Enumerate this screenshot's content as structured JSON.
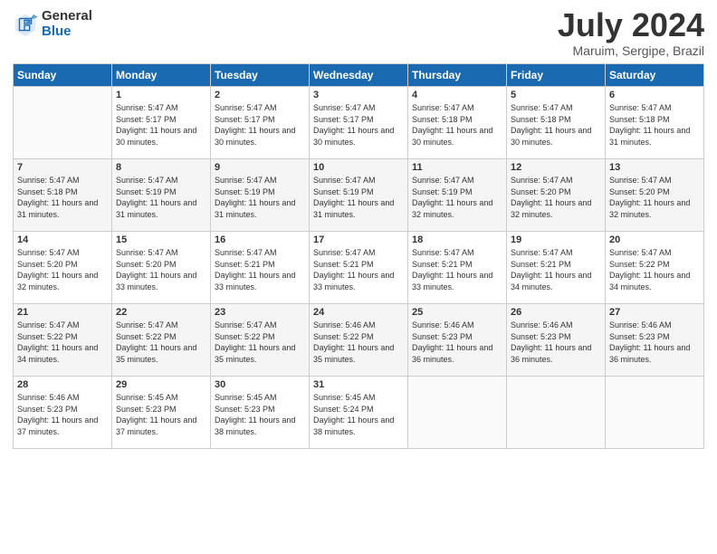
{
  "header": {
    "logo_general": "General",
    "logo_blue": "Blue",
    "month_title": "July 2024",
    "location": "Maruim, Sergipe, Brazil"
  },
  "days_of_week": [
    "Sunday",
    "Monday",
    "Tuesday",
    "Wednesday",
    "Thursday",
    "Friday",
    "Saturday"
  ],
  "weeks": [
    [
      {
        "num": "",
        "sunrise": "",
        "sunset": "",
        "daylight": ""
      },
      {
        "num": "1",
        "sunrise": "Sunrise: 5:47 AM",
        "sunset": "Sunset: 5:17 PM",
        "daylight": "Daylight: 11 hours and 30 minutes."
      },
      {
        "num": "2",
        "sunrise": "Sunrise: 5:47 AM",
        "sunset": "Sunset: 5:17 PM",
        "daylight": "Daylight: 11 hours and 30 minutes."
      },
      {
        "num": "3",
        "sunrise": "Sunrise: 5:47 AM",
        "sunset": "Sunset: 5:17 PM",
        "daylight": "Daylight: 11 hours and 30 minutes."
      },
      {
        "num": "4",
        "sunrise": "Sunrise: 5:47 AM",
        "sunset": "Sunset: 5:18 PM",
        "daylight": "Daylight: 11 hours and 30 minutes."
      },
      {
        "num": "5",
        "sunrise": "Sunrise: 5:47 AM",
        "sunset": "Sunset: 5:18 PM",
        "daylight": "Daylight: 11 hours and 30 minutes."
      },
      {
        "num": "6",
        "sunrise": "Sunrise: 5:47 AM",
        "sunset": "Sunset: 5:18 PM",
        "daylight": "Daylight: 11 hours and 31 minutes."
      }
    ],
    [
      {
        "num": "7",
        "sunrise": "Sunrise: 5:47 AM",
        "sunset": "Sunset: 5:18 PM",
        "daylight": "Daylight: 11 hours and 31 minutes."
      },
      {
        "num": "8",
        "sunrise": "Sunrise: 5:47 AM",
        "sunset": "Sunset: 5:19 PM",
        "daylight": "Daylight: 11 hours and 31 minutes."
      },
      {
        "num": "9",
        "sunrise": "Sunrise: 5:47 AM",
        "sunset": "Sunset: 5:19 PM",
        "daylight": "Daylight: 11 hours and 31 minutes."
      },
      {
        "num": "10",
        "sunrise": "Sunrise: 5:47 AM",
        "sunset": "Sunset: 5:19 PM",
        "daylight": "Daylight: 11 hours and 31 minutes."
      },
      {
        "num": "11",
        "sunrise": "Sunrise: 5:47 AM",
        "sunset": "Sunset: 5:19 PM",
        "daylight": "Daylight: 11 hours and 32 minutes."
      },
      {
        "num": "12",
        "sunrise": "Sunrise: 5:47 AM",
        "sunset": "Sunset: 5:20 PM",
        "daylight": "Daylight: 11 hours and 32 minutes."
      },
      {
        "num": "13",
        "sunrise": "Sunrise: 5:47 AM",
        "sunset": "Sunset: 5:20 PM",
        "daylight": "Daylight: 11 hours and 32 minutes."
      }
    ],
    [
      {
        "num": "14",
        "sunrise": "Sunrise: 5:47 AM",
        "sunset": "Sunset: 5:20 PM",
        "daylight": "Daylight: 11 hours and 32 minutes."
      },
      {
        "num": "15",
        "sunrise": "Sunrise: 5:47 AM",
        "sunset": "Sunset: 5:20 PM",
        "daylight": "Daylight: 11 hours and 33 minutes."
      },
      {
        "num": "16",
        "sunrise": "Sunrise: 5:47 AM",
        "sunset": "Sunset: 5:21 PM",
        "daylight": "Daylight: 11 hours and 33 minutes."
      },
      {
        "num": "17",
        "sunrise": "Sunrise: 5:47 AM",
        "sunset": "Sunset: 5:21 PM",
        "daylight": "Daylight: 11 hours and 33 minutes."
      },
      {
        "num": "18",
        "sunrise": "Sunrise: 5:47 AM",
        "sunset": "Sunset: 5:21 PM",
        "daylight": "Daylight: 11 hours and 33 minutes."
      },
      {
        "num": "19",
        "sunrise": "Sunrise: 5:47 AM",
        "sunset": "Sunset: 5:21 PM",
        "daylight": "Daylight: 11 hours and 34 minutes."
      },
      {
        "num": "20",
        "sunrise": "Sunrise: 5:47 AM",
        "sunset": "Sunset: 5:22 PM",
        "daylight": "Daylight: 11 hours and 34 minutes."
      }
    ],
    [
      {
        "num": "21",
        "sunrise": "Sunrise: 5:47 AM",
        "sunset": "Sunset: 5:22 PM",
        "daylight": "Daylight: 11 hours and 34 minutes."
      },
      {
        "num": "22",
        "sunrise": "Sunrise: 5:47 AM",
        "sunset": "Sunset: 5:22 PM",
        "daylight": "Daylight: 11 hours and 35 minutes."
      },
      {
        "num": "23",
        "sunrise": "Sunrise: 5:47 AM",
        "sunset": "Sunset: 5:22 PM",
        "daylight": "Daylight: 11 hours and 35 minutes."
      },
      {
        "num": "24",
        "sunrise": "Sunrise: 5:46 AM",
        "sunset": "Sunset: 5:22 PM",
        "daylight": "Daylight: 11 hours and 35 minutes."
      },
      {
        "num": "25",
        "sunrise": "Sunrise: 5:46 AM",
        "sunset": "Sunset: 5:23 PM",
        "daylight": "Daylight: 11 hours and 36 minutes."
      },
      {
        "num": "26",
        "sunrise": "Sunrise: 5:46 AM",
        "sunset": "Sunset: 5:23 PM",
        "daylight": "Daylight: 11 hours and 36 minutes."
      },
      {
        "num": "27",
        "sunrise": "Sunrise: 5:46 AM",
        "sunset": "Sunset: 5:23 PM",
        "daylight": "Daylight: 11 hours and 36 minutes."
      }
    ],
    [
      {
        "num": "28",
        "sunrise": "Sunrise: 5:46 AM",
        "sunset": "Sunset: 5:23 PM",
        "daylight": "Daylight: 11 hours and 37 minutes."
      },
      {
        "num": "29",
        "sunrise": "Sunrise: 5:45 AM",
        "sunset": "Sunset: 5:23 PM",
        "daylight": "Daylight: 11 hours and 37 minutes."
      },
      {
        "num": "30",
        "sunrise": "Sunrise: 5:45 AM",
        "sunset": "Sunset: 5:23 PM",
        "daylight": "Daylight: 11 hours and 38 minutes."
      },
      {
        "num": "31",
        "sunrise": "Sunrise: 5:45 AM",
        "sunset": "Sunset: 5:24 PM",
        "daylight": "Daylight: 11 hours and 38 minutes."
      },
      {
        "num": "",
        "sunrise": "",
        "sunset": "",
        "daylight": ""
      },
      {
        "num": "",
        "sunrise": "",
        "sunset": "",
        "daylight": ""
      },
      {
        "num": "",
        "sunrise": "",
        "sunset": "",
        "daylight": ""
      }
    ]
  ]
}
